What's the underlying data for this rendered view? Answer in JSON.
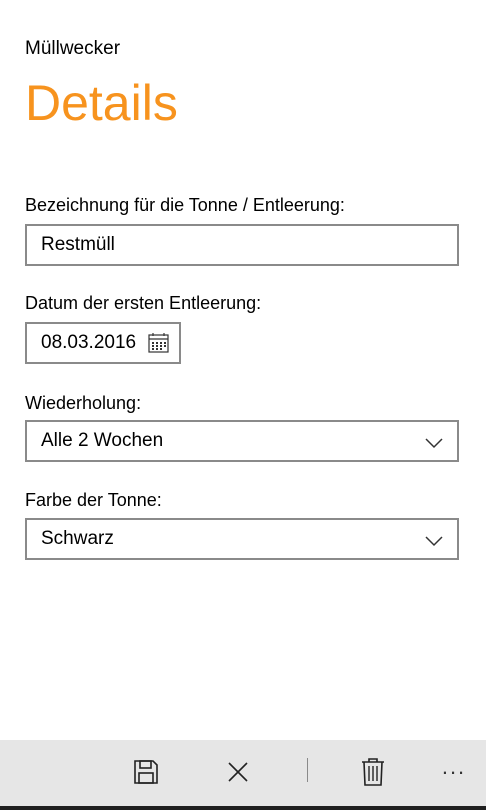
{
  "app": {
    "name": "Müllwecker",
    "page_title": "Details"
  },
  "colors": {
    "accent": "#f7931e",
    "border": "#8a8a8a",
    "appbar": "#e6e6e6"
  },
  "form": {
    "name_label": "Bezeichnung für die Tonne / Entleerung:",
    "name_value": "Restmüll",
    "date_label": "Datum der ersten Entleerung:",
    "date_value": "08.03.2016",
    "repeat_label": "Wiederholung:",
    "repeat_value": "Alle 2 Wochen",
    "color_label": "Farbe der Tonne:",
    "color_value": "Schwarz"
  },
  "appbar": {
    "buttons": [
      {
        "icon": "save-icon"
      },
      {
        "icon": "close-icon"
      },
      {
        "icon": "delete-icon"
      }
    ],
    "more": "..."
  }
}
